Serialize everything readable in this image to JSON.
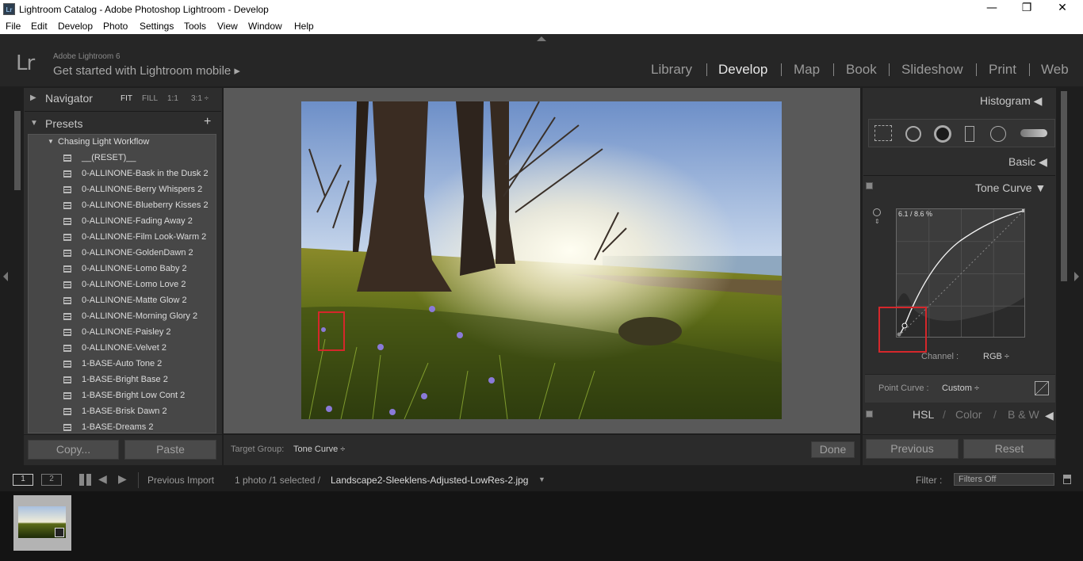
{
  "window": {
    "title": "Lightroom Catalog - Adobe Photoshop Lightroom - Develop",
    "app_icon": "Lr"
  },
  "menu": [
    "File",
    "Edit",
    "Develop",
    "Photo",
    "Settings",
    "Tools",
    "View",
    "Window",
    "Help"
  ],
  "identity": {
    "logo": "Lr",
    "version": "Adobe Lightroom 6",
    "mobile": "Get started with Lightroom mobile ▸"
  },
  "modules": [
    "Library",
    "Develop",
    "Map",
    "Book",
    "Slideshow",
    "Print",
    "Web"
  ],
  "active_module": "Develop",
  "navigator": {
    "label": "Navigator",
    "zoom": [
      "FIT",
      "FILL",
      "1:1",
      "3:1 ÷"
    ]
  },
  "presets": {
    "label": "Presets",
    "add": "+",
    "folder": "Chasing Light Workflow",
    "items": [
      "__(RESET)__",
      "0-ALLINONE-Bask in the Dusk 2",
      "0-ALLINONE-Berry Whispers 2",
      "0-ALLINONE-Blueberry Kisses 2",
      "0-ALLINONE-Fading Away 2",
      "0-ALLINONE-Film Look-Warm 2",
      "0-ALLINONE-GoldenDawn 2",
      "0-ALLINONE-Lomo Baby 2",
      "0-ALLINONE-Lomo Love 2",
      "0-ALLINONE-Matte Glow 2",
      "0-ALLINONE-Morning Glory 2",
      "0-ALLINONE-Paisley 2",
      "0-ALLINONE-Velvet 2",
      "1-BASE-Auto Tone 2",
      "1-BASE-Bright Base 2",
      "1-BASE-Bright Low Cont 2",
      "1-BASE-Brisk Dawn 2",
      "1-BASE-Dreams 2"
    ]
  },
  "left_buttons": {
    "copy": "Copy...",
    "paste": "Paste"
  },
  "toolbar": {
    "target_label": "Target Group:",
    "target_value": "Tone Curve ÷",
    "done": "Done"
  },
  "right": {
    "histogram": "Histogram ◀",
    "basic": "Basic ◀",
    "tone_curve": "Tone Curve ▼",
    "readout": "6.1 / 8.6 %",
    "channel_label": "Channel :",
    "channel_value": "RGB ÷",
    "point_curve_label": "Point Curve :",
    "point_curve_value": "Custom ÷",
    "hsl": "HSL",
    "color": "Color",
    "bw": "B & W",
    "hsl_arrow": "◀",
    "sep": "/",
    "previous": "Previous",
    "reset": "Reset"
  },
  "filmbar": {
    "view1": "1",
    "view2": "2",
    "source": "Previous Import",
    "count": "1 photo /1 selected /",
    "filename": "Landscape2-Sleeklens-Adjusted-LowRes-2.jpg",
    "filter_label": "Filter :",
    "filter_value": "Filters Off"
  },
  "colors": {
    "accent_red": "#d5272b",
    "panel": "#2d2d2d",
    "preset_bg": "#474747"
  }
}
